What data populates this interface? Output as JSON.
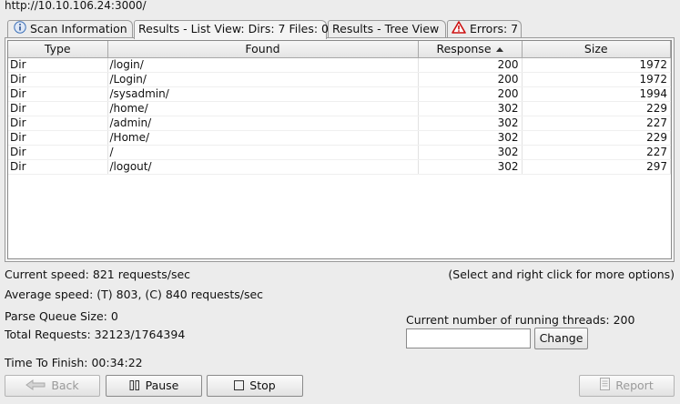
{
  "target_url": "http://10.10.106.24:3000/",
  "tabs": [
    {
      "label": "Scan Information",
      "icon": "info-icon"
    },
    {
      "label": "Results - List View: Dirs: 7 Files: 0"
    },
    {
      "label": "Results - Tree View"
    },
    {
      "label": "Errors: 7",
      "icon": "warning-icon"
    }
  ],
  "table": {
    "columns": [
      "Type",
      "Found",
      "Response",
      "Size"
    ],
    "sorted_column": "Response",
    "sort_direction": "ascending",
    "rows": [
      {
        "type": "Dir",
        "found": "/login/",
        "response": "200",
        "size": "1972"
      },
      {
        "type": "Dir",
        "found": "/Login/",
        "response": "200",
        "size": "1972"
      },
      {
        "type": "Dir",
        "found": "/sysadmin/",
        "response": "200",
        "size": "1994"
      },
      {
        "type": "Dir",
        "found": "/home/",
        "response": "302",
        "size": "229"
      },
      {
        "type": "Dir",
        "found": "/admin/",
        "response": "302",
        "size": "227"
      },
      {
        "type": "Dir",
        "found": "/Home/",
        "response": "302",
        "size": "229"
      },
      {
        "type": "Dir",
        "found": "/",
        "response": "302",
        "size": "227"
      },
      {
        "type": "Dir",
        "found": "/logout/",
        "response": "302",
        "size": "297"
      }
    ]
  },
  "status": {
    "current_speed": "Current speed: 821 requests/sec",
    "hint": "(Select and right click for more options)",
    "average_speed": "Average speed: (T) 803, (C) 840 requests/sec",
    "parse_queue": "Parse Queue Size: 0",
    "total_requests": "Total Requests: 32123/1764394",
    "threads_label": "Current number of running threads: 200",
    "threads_input_value": "",
    "time_to_finish": "Time To Finish: 00:34:22"
  },
  "buttons": {
    "change": "Change",
    "back": "Back",
    "pause": "Pause",
    "stop": "Stop",
    "report": "Report"
  },
  "colors": {
    "warning": "#cc1111",
    "info": "#3a6fb8"
  }
}
